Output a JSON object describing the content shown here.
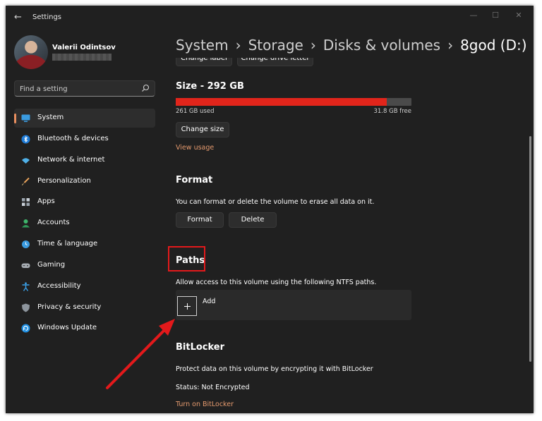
{
  "app": {
    "title": "Settings"
  },
  "window_controls": {
    "minimize": "—",
    "maximize": "☐",
    "close": "✕"
  },
  "profile": {
    "name": "Valerii Odintsov",
    "email_redacted": true
  },
  "search": {
    "placeholder": "Find a setting"
  },
  "sidebar": {
    "items": [
      {
        "label": "System",
        "icon": "system-icon",
        "active": true
      },
      {
        "label": "Bluetooth & devices",
        "icon": "bluetooth-icon"
      },
      {
        "label": "Network & internet",
        "icon": "wifi-icon"
      },
      {
        "label": "Personalization",
        "icon": "brush-icon"
      },
      {
        "label": "Apps",
        "icon": "apps-icon"
      },
      {
        "label": "Accounts",
        "icon": "account-icon"
      },
      {
        "label": "Time & language",
        "icon": "globe-clock-icon"
      },
      {
        "label": "Gaming",
        "icon": "gamepad-icon"
      },
      {
        "label": "Accessibility",
        "icon": "accessibility-icon"
      },
      {
        "label": "Privacy & security",
        "icon": "shield-icon"
      },
      {
        "label": "Windows Update",
        "icon": "update-icon"
      }
    ]
  },
  "breadcrumb": {
    "items": [
      "System",
      "Storage",
      "Disks & volumes",
      "8god (D:)"
    ],
    "separator": "›"
  },
  "top_buttons": {
    "change_label": "Change label",
    "change_drive_letter": "Change drive letter"
  },
  "size": {
    "title": "Size - 292 GB",
    "used_label": "261 GB used",
    "free_label": "31.8 GB free",
    "used_fraction": 0.894,
    "change_size_button": "Change size",
    "view_usage_link": "View usage"
  },
  "format": {
    "title": "Format",
    "description": "You can format or delete the volume to erase all data on it.",
    "format_button": "Format",
    "delete_button": "Delete"
  },
  "paths": {
    "title": "Paths",
    "description": "Allow access to this volume using the following NTFS paths.",
    "add_label": "Add"
  },
  "bitlocker": {
    "title": "BitLocker",
    "description": "Protect data on this volume by encrypting it with BitLocker",
    "status": "Status: Not Encrypted",
    "turn_on_link": "Turn on BitLocker"
  },
  "colors": {
    "accent": "#e98f5f",
    "link": "#e59a6e",
    "usage_bar": "#e1251b",
    "annotation": "#e3191b"
  }
}
